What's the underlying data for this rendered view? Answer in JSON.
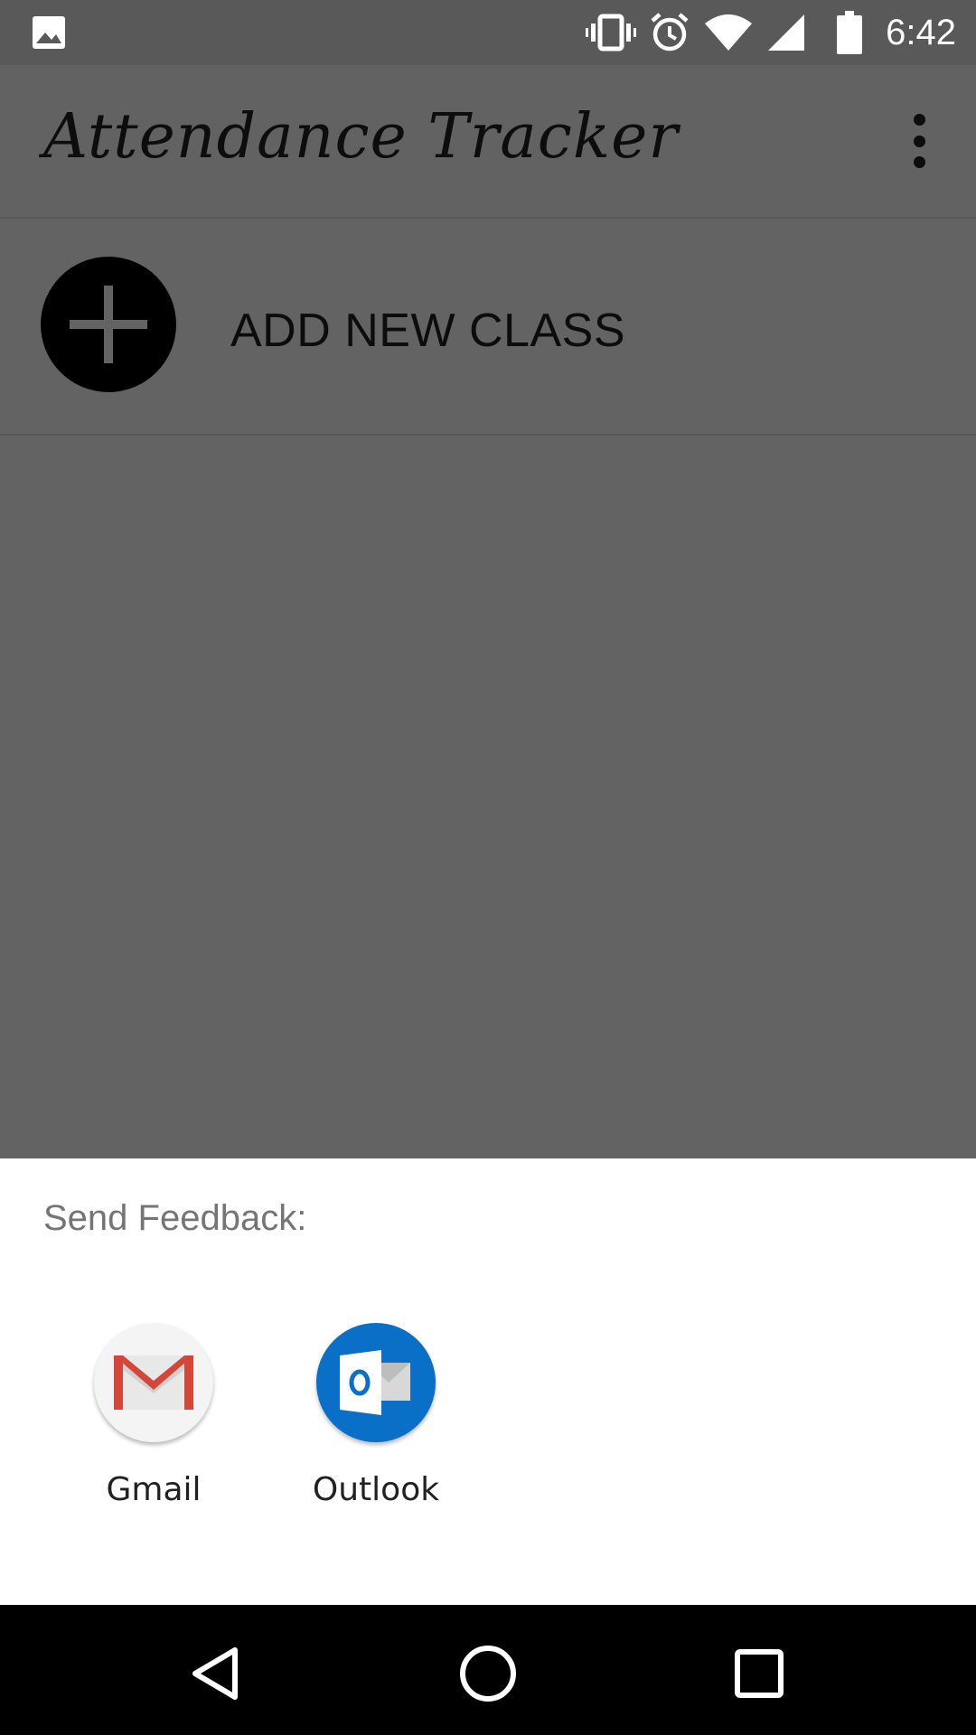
{
  "status_bar": {
    "time": "6:42",
    "icons": [
      "image-icon",
      "vibrate-icon",
      "alarm-icon",
      "wifi-icon",
      "signal-icon",
      "battery-icon"
    ]
  },
  "app_bar": {
    "title": "Attendance Tracker",
    "menu_icon": "more-vert-icon"
  },
  "main": {
    "add_class_label": "ADD NEW CLASS",
    "add_icon": "plus-icon"
  },
  "share_sheet": {
    "title": "Send Feedback:",
    "apps": [
      {
        "label": "Gmail",
        "icon": "gmail-icon"
      },
      {
        "label": "Outlook",
        "icon": "outlook-icon"
      }
    ]
  },
  "nav_bar": {
    "icons": [
      "back-icon",
      "home-icon",
      "recents-icon"
    ]
  },
  "colors": {
    "scrim": "#636363",
    "sheet": "#ffffff",
    "gmail_red": "#d44638",
    "outlook_blue": "#0a6fc7"
  }
}
